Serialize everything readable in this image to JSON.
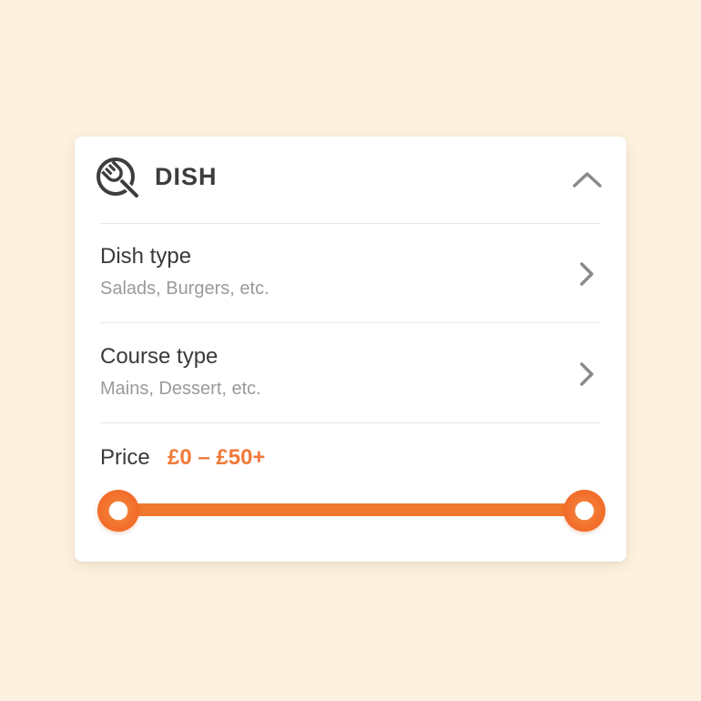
{
  "panel": {
    "title": "DISH",
    "icon": "plate-fork-icon",
    "collapse_icon": "chevron-up-icon"
  },
  "filters": [
    {
      "title": "Dish type",
      "subtitle": "Salads, Burgers, etc.",
      "icon": "chevron-right-icon"
    },
    {
      "title": "Course type",
      "subtitle": "Mains, Dessert, etc.",
      "icon": "chevron-right-icon"
    }
  ],
  "price": {
    "label": "Price",
    "range_text": "£0 – £50+",
    "min_fraction": 0,
    "max_fraction": 1
  },
  "colors": {
    "background": "#fdf1df",
    "accent": "#f07a3a",
    "text": "#3a3a3a",
    "muted": "#9a9a9a"
  }
}
